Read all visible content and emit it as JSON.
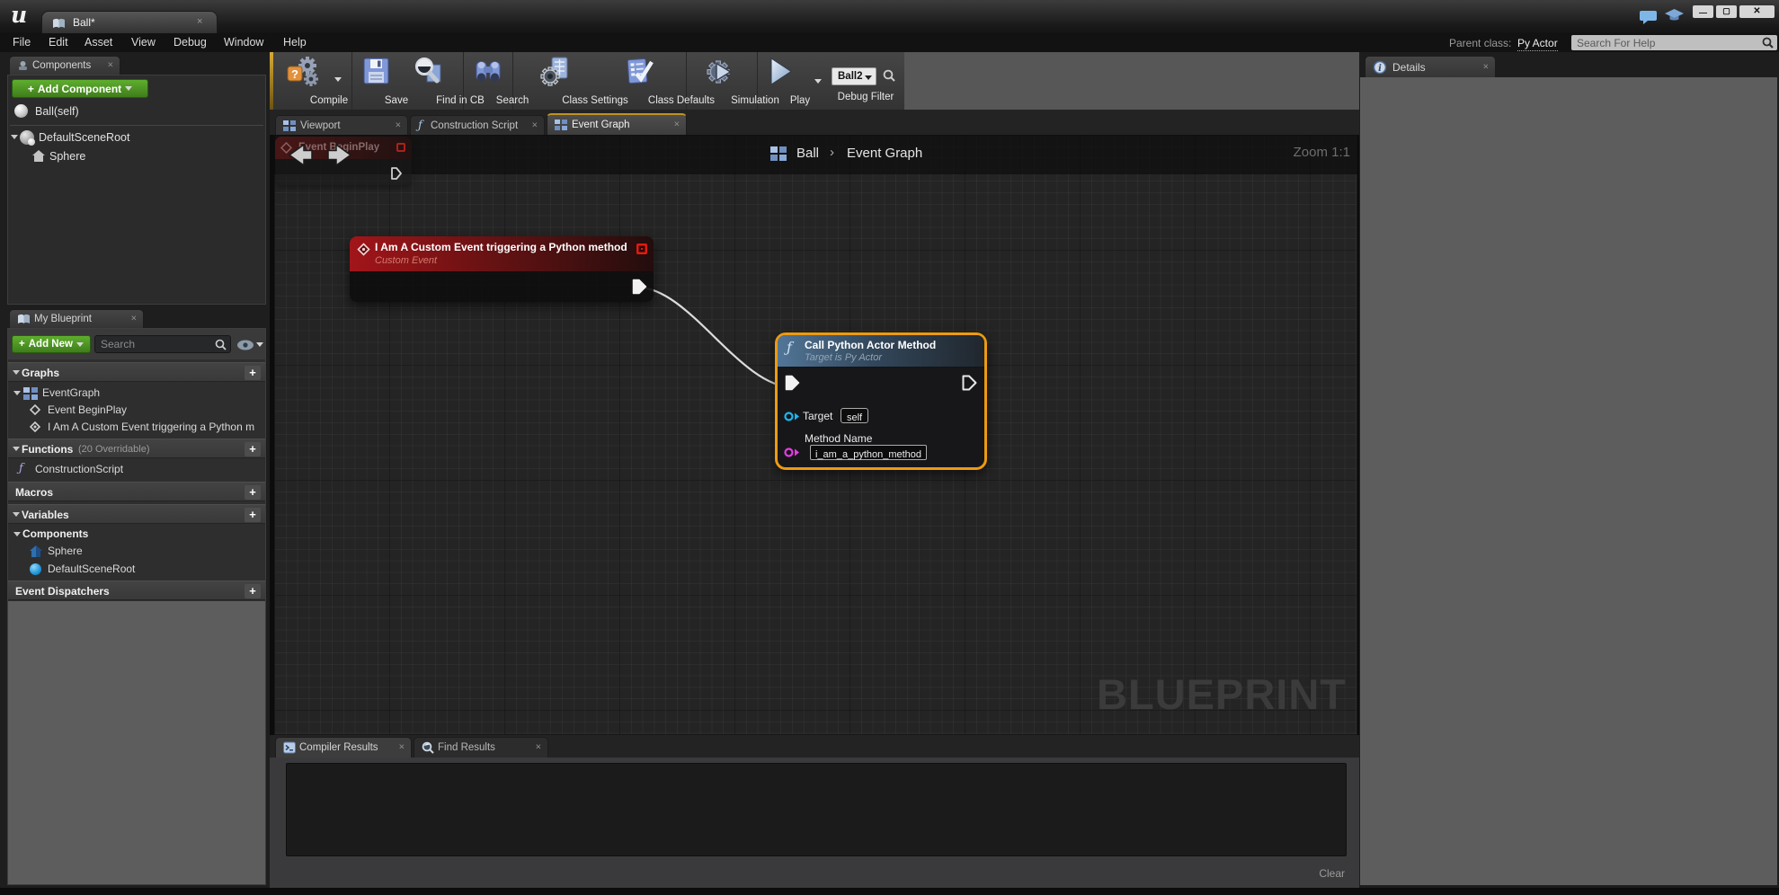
{
  "window": {
    "logo": "u",
    "tab_title": "Ball*",
    "min_glyph": "—",
    "max_glyph": "▢",
    "close_glyph": "✕"
  },
  "menu": {
    "items": [
      "File",
      "Edit",
      "Asset",
      "View",
      "Debug",
      "Window",
      "Help"
    ],
    "parent_class_label": "Parent class:",
    "parent_class_value": "Py Actor",
    "help_search_placeholder": "Search For Help"
  },
  "toolbar": {
    "compile": "Compile",
    "save": "Save",
    "find_in_cb": "Find in CB",
    "search": "Search",
    "class_settings": "Class Settings",
    "class_defaults": "Class Defaults",
    "simulation": "Simulation",
    "play": "Play",
    "debug_target": "Ball2",
    "debug_filter": "Debug Filter"
  },
  "components_panel": {
    "title": "Components",
    "add_button": "Add Component",
    "root_item": "Ball(self)",
    "scene_root": "DefaultSceneRoot",
    "sphere": "Sphere"
  },
  "my_blueprint": {
    "title": "My Blueprint",
    "add_button": "Add New",
    "search_placeholder": "Search",
    "graphs_header": "Graphs",
    "event_graph": "EventGraph",
    "event_begin_play": "Event BeginPlay",
    "custom_event_item": "I Am A Custom Event triggering a Python m",
    "functions_header": "Functions",
    "functions_note": "(20 Overridable)",
    "construction_script": "ConstructionScript",
    "macros_header": "Macros",
    "variables_header": "Variables",
    "components_header": "Components",
    "var_sphere": "Sphere",
    "var_scene_root": "DefaultSceneRoot",
    "dispatchers_header": "Event Dispatchers"
  },
  "graph": {
    "tabs": [
      "Viewport",
      "Construction Script",
      "Event Graph"
    ],
    "breadcrumb_root": "Ball",
    "breadcrumb_sep": "›",
    "breadcrumb_current": "Event Graph",
    "zoom_label": "Zoom 1:1",
    "watermark": "BLUEPRINT",
    "ghost_node_title": "Event BeginPlay"
  },
  "nodes": {
    "custom_event": {
      "title": "I Am A Custom Event triggering a Python method",
      "subtitle": "Custom Event"
    },
    "call_method": {
      "title": "Call Python Actor Method",
      "subtitle": "Target is Py Actor",
      "target_label": "Target",
      "target_value": "self",
      "method_label": "Method Name",
      "method_value": "i_am_a_python_method"
    }
  },
  "bottom_panel": {
    "tabs": [
      "Compiler Results",
      "Find Results"
    ],
    "clear_button": "Clear"
  },
  "details_panel": {
    "title": "Details"
  },
  "colors": {
    "selection_orange": "#ee9a10",
    "node_red": "#9e1418",
    "node_blue": "#4f7396",
    "pin_exec": "#f2f2f2",
    "pin_target": "#1cb6f0",
    "pin_string": "#e23ee2",
    "active_tab_accent": "#bf9323",
    "green_button": "#4c9a22",
    "empty_panel_gray": "#5d5d5d"
  }
}
